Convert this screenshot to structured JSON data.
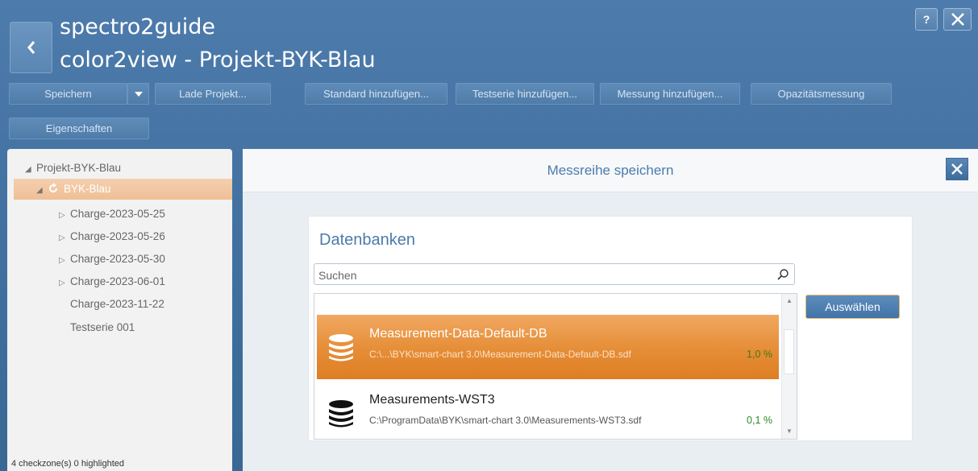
{
  "header": {
    "app_title": "spectro2guide",
    "project_title": "color2view - Projekt-BYK-Blau",
    "help_label": "?"
  },
  "toolbar": {
    "save_label": "Speichern",
    "load_project_label": "Lade Projekt...",
    "add_standard_label": "Standard hinzufügen...",
    "add_test_series_label": "Testserie hinzufügen...",
    "add_measurement_label": "Messung hinzufügen...",
    "opacity_label": "Opazitätsmessung",
    "properties_label": "Eigenschaften"
  },
  "tree": {
    "root": "Projekt-BYK-Blau",
    "selected": "BYK-Blau",
    "items": [
      "Charge-2023-05-25",
      "Charge-2023-05-26",
      "Charge-2023-05-30",
      "Charge-2023-06-01",
      "Charge-2023-11-22",
      "Testserie 001"
    ],
    "status": "4 checkzone(s) 0 highlighted"
  },
  "dialog": {
    "title": "Messreihe speichern",
    "section_title": "Datenbanken",
    "search_placeholder": "Suchen",
    "select_button": "Auswählen",
    "databases": [
      {
        "name": "Measurement-Data-Default-DB",
        "path": "C:\\...\\BYK\\smart-chart 3.0\\Measurement-Data-Default-DB.sdf",
        "percent": "1,0 %",
        "selected": true
      },
      {
        "name": "Measurements-WST3",
        "path": "C:\\ProgramData\\BYK\\smart-chart 3.0\\Measurements-WST3.sdf",
        "percent": "0,1 %",
        "selected": false
      }
    ]
  },
  "colors": {
    "accent": "#4c7bab",
    "selection_orange": "#e58d36",
    "tree_selection": "#efbf96"
  },
  "icons": {
    "back": "chevron-left-icon",
    "help": "help-icon",
    "close": "close-icon",
    "search": "search-icon",
    "database": "database-icon",
    "dropdown": "chevron-down-icon",
    "refresh": "refresh-icon"
  }
}
